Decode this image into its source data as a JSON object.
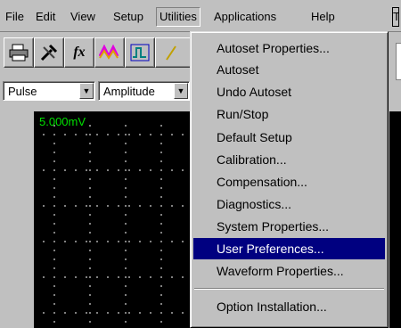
{
  "menubar": {
    "items": [
      "File",
      "Edit",
      "View",
      "Setup",
      "Utilities",
      "Applications",
      "Help",
      "T"
    ]
  },
  "toolbar": {
    "buttons": [
      "print-icon",
      "tools-icon",
      "function-icon",
      "waveform-icon",
      "pulse-icon",
      "triangle-icon"
    ]
  },
  "selectors": {
    "pulse": "Pulse",
    "amplitude": "Amplitude"
  },
  "scope": {
    "label": "5.000mV",
    "trace_color": "#00e000",
    "background": "#000000"
  },
  "utilities_menu": {
    "items": [
      "Autoset Properties...",
      "Autoset",
      "Undo Autoset",
      "Run/Stop",
      "Default Setup",
      "Calibration...",
      "Compensation...",
      "Diagnostics...",
      "System Properties...",
      "User Preferences...",
      "Waveform Properties...",
      "Option Installation..."
    ],
    "highlighted": "User Preferences...",
    "highlight_color": "#000080"
  }
}
